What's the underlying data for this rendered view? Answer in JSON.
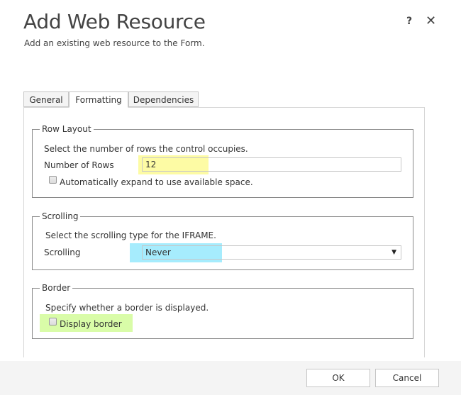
{
  "dialog": {
    "title": "Add Web Resource",
    "subtitle": "Add an existing web resource to the Form.",
    "help_label": "?",
    "close_label": "✕"
  },
  "tabs": [
    {
      "label": "General",
      "active": false
    },
    {
      "label": "Formatting",
      "active": true
    },
    {
      "label": "Dependencies",
      "active": false
    }
  ],
  "row_layout": {
    "legend": "Row Layout",
    "description": "Select the number of rows the control occupies.",
    "rows_label": "Number of Rows",
    "rows_value": "12",
    "auto_expand_label": "Automatically expand to use available space.",
    "auto_expand_checked": false
  },
  "scrolling": {
    "legend": "Scrolling",
    "description": "Select the scrolling type for the IFRAME.",
    "label": "Scrolling",
    "selected": "Never"
  },
  "border": {
    "legend": "Border",
    "description": "Specify whether a border is displayed.",
    "display_border_label": "Display border",
    "display_border_checked": false
  },
  "footer": {
    "ok_label": "OK",
    "cancel_label": "Cancel"
  },
  "highlight_colors": {
    "rows": "#fdfba4",
    "scrolling": "#a6ecfd",
    "border": "#d9fca8"
  }
}
